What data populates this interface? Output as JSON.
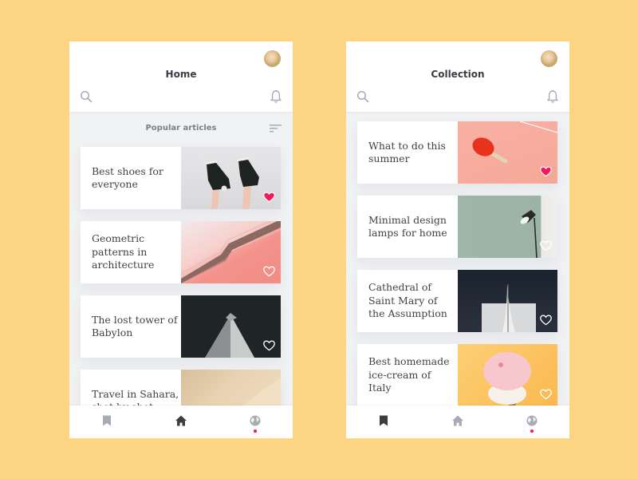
{
  "colors": {
    "background": "#fdd482",
    "accent": "#f2195c",
    "active_icon": "#3a3d44",
    "inactive_icon": "#a6abb5"
  },
  "screens": [
    {
      "title": "Home",
      "avatar": "user-avatar",
      "icons": {
        "search": "search-icon",
        "notifications": "bell-icon",
        "sort": "sort-icon"
      },
      "section_label": "Popular articles",
      "articles": [
        {
          "title": "Best shoes for everyone",
          "image": "sneakers-photo",
          "liked": true
        },
        {
          "title": "Geometric patterns in architecture",
          "image": "pink-architecture-photo",
          "liked": false
        },
        {
          "title": "The lost tower of Babylon",
          "image": "tower-photo",
          "liked": false
        },
        {
          "title": "Travel in Sahara, shot by shot",
          "image": "sahara-dune-photo",
          "liked": false
        }
      ],
      "tabs": [
        {
          "name": "bookmarks",
          "icon": "bookmark-icon",
          "active": false
        },
        {
          "name": "home",
          "icon": "home-icon",
          "active": true
        },
        {
          "name": "explore",
          "icon": "globe-icon",
          "active": false,
          "badge_dot": true
        }
      ]
    },
    {
      "title": "Collection",
      "avatar": "user-avatar",
      "icons": {
        "search": "search-icon",
        "notifications": "bell-icon"
      },
      "articles": [
        {
          "title": "What to do this summer",
          "image": "ping-pong-paddle-photo",
          "liked": true
        },
        {
          "title": "Minimal design lamps for home",
          "image": "floor-lamp-photo",
          "liked": false
        },
        {
          "title": "Cathedral of Saint Mary of the Assumption",
          "image": "cathedral-photo",
          "liked": false
        },
        {
          "title": "Best homemade ice-cream of Italy",
          "image": "ice-cream-photo",
          "liked": false
        }
      ],
      "tabs": [
        {
          "name": "bookmarks",
          "icon": "bookmark-icon",
          "active": true
        },
        {
          "name": "home",
          "icon": "home-icon",
          "active": false
        },
        {
          "name": "explore",
          "icon": "globe-icon",
          "active": false,
          "badge_dot": true
        }
      ]
    }
  ]
}
